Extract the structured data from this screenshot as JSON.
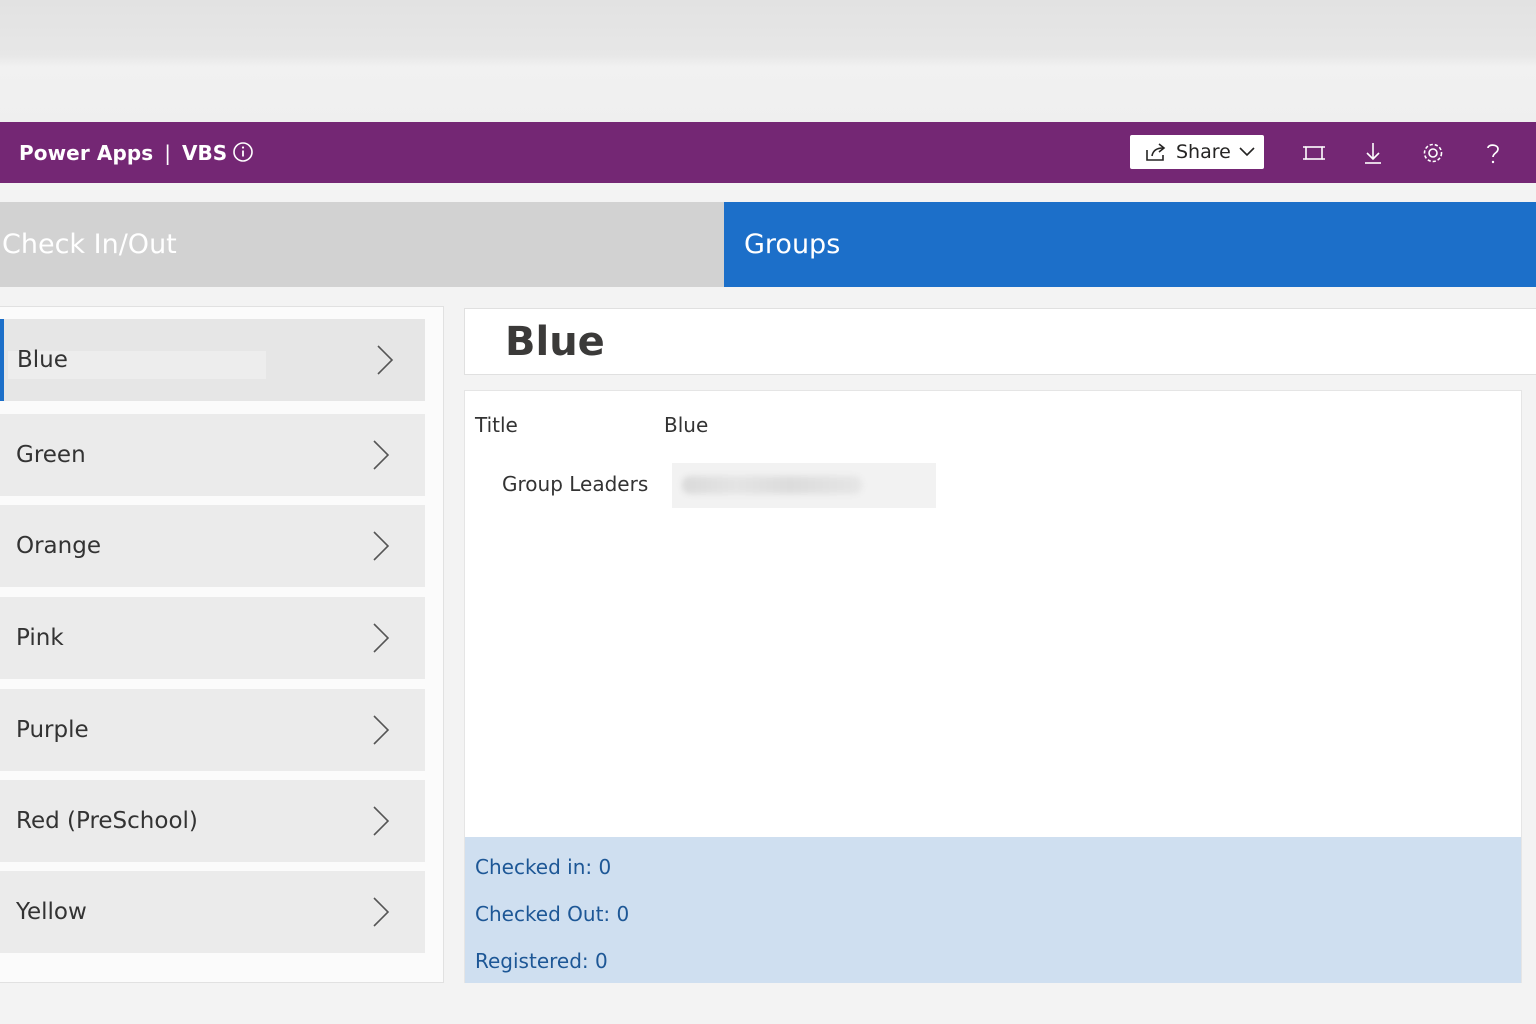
{
  "app_bar": {
    "app_name": "Power Apps",
    "separator": "|",
    "app_title": "VBS",
    "share_label": "Share",
    "background_color": "#742774",
    "icons": [
      "info-icon",
      "share-icon",
      "chevron-down-icon",
      "fit-to-screen-icon",
      "download-icon",
      "settings-icon",
      "help-icon"
    ]
  },
  "nav": {
    "tab_check": "Check In/Out",
    "tab_groups": "Groups",
    "active_color": "#1c6fc9"
  },
  "groups": {
    "items": [
      {
        "label": "Blue",
        "selected": true
      },
      {
        "label": "Green"
      },
      {
        "label": "Orange"
      },
      {
        "label": "Pink"
      },
      {
        "label": "Purple"
      },
      {
        "label": "Red (PreSchool)"
      },
      {
        "label": "Yellow"
      }
    ]
  },
  "detail": {
    "header_title": "Blue",
    "title_label": "Title",
    "title_value": "Blue",
    "leaders_label": "Group Leaders",
    "stats": {
      "checked_in": "Checked in: 0",
      "checked_out": "Checked Out: 0",
      "registered": "Registered: 0"
    }
  }
}
